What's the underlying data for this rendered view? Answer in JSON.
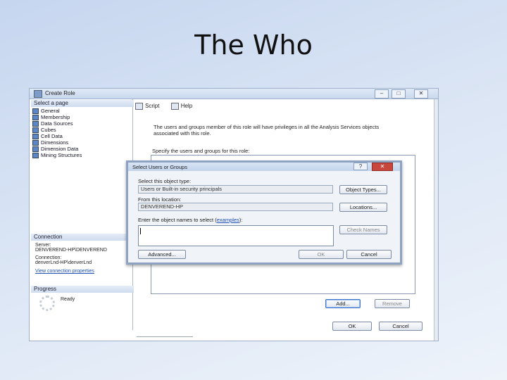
{
  "slide": {
    "title": "The Who"
  },
  "window": {
    "title": "Create Role",
    "minimize": "–",
    "maximize": "□",
    "close": "✕"
  },
  "left_pane": {
    "select_page_header": "Select a page",
    "pages": [
      "General",
      "Membership",
      "Data Sources",
      "Cubes",
      "Cell Data",
      "Dimensions",
      "Dimension Data",
      "Mining Structures"
    ],
    "connection_header": "Connection",
    "server_label": "Server:",
    "server_value": "DENVEREND-HP\\DENVEREND",
    "connection_label": "Connection:",
    "connection_value": "denverLnd-HP\\denverLnd",
    "view_connection_link": "View connection properties",
    "progress_header": "Progress",
    "progress_status": "Ready"
  },
  "toolbar": {
    "script": "Script",
    "help": "Help"
  },
  "main": {
    "description": "The users and groups member of this role will have privileges in all the Analysis Services objects associated with this role.",
    "specify_label": "Specify the users and groups for this role:",
    "add_button": "Add...",
    "remove_button": "Remove",
    "ok_button": "OK",
    "cancel_button": "Cancel"
  },
  "dialog": {
    "title": "Select Users or Groups",
    "help": "?",
    "close": "✕",
    "object_type_label": "Select this object type:",
    "object_type_value": "Users or Built-in security principals",
    "object_types_button": "Object Types...",
    "location_label": "From this location:",
    "location_value": "DENVEREND-HP",
    "locations_button": "Locations...",
    "names_label_prefix": "Enter the object names to select (",
    "names_label_link": "examples",
    "names_label_suffix": "):",
    "names_value": "",
    "check_names_button": "Check Names",
    "advanced_button": "Advanced...",
    "ok_button": "OK",
    "cancel_button": "Cancel"
  }
}
